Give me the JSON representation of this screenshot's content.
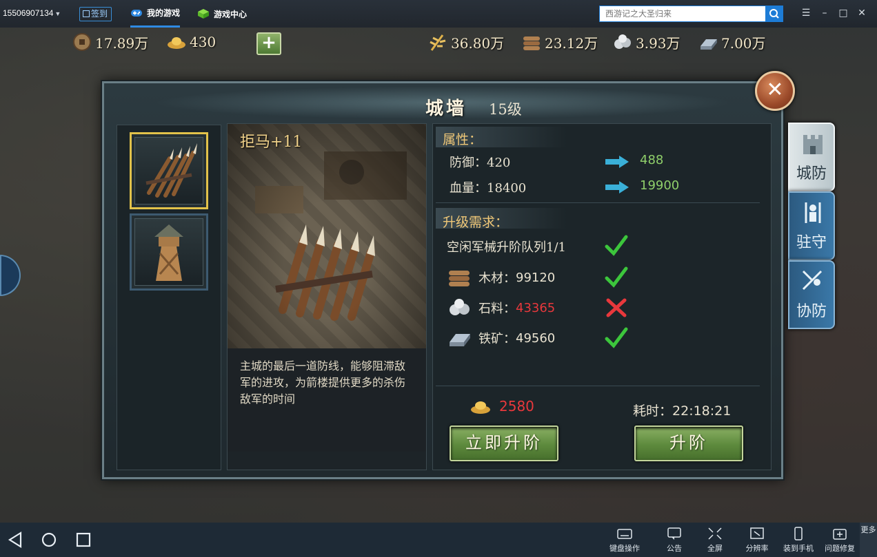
{
  "topbar": {
    "account": "15506907134",
    "signin_label": "签到",
    "tabs": [
      {
        "label": "我的游戏"
      },
      {
        "label": "游戏中心"
      }
    ],
    "search_placeholder": "西游记之大圣归来",
    "window_buttons": [
      "menu-icon",
      "minimize-icon",
      "maximize-icon",
      "close-icon"
    ]
  },
  "resources": {
    "copper": "17.89万",
    "gold": "430",
    "food": "36.80万",
    "wood": "23.12万",
    "stone": "3.93万",
    "iron": "7.00万"
  },
  "dialog": {
    "title": "城墙",
    "level": "15级",
    "item_name": "拒马+11",
    "description": "主城的最后一道防线，能够阻滞敌军的进攻，为箭楼提供更多的杀伤敌军的时间",
    "attributes_head": "属性：",
    "stats": [
      {
        "label": "防御：420",
        "new": "488"
      },
      {
        "label": "血量：18400",
        "new": "19900"
      }
    ],
    "requirements_head": "升级需求：",
    "queue": "空闲军械升阶队列1/1",
    "requirements": [
      {
        "name": "木材：",
        "value": "99120",
        "ok": true
      },
      {
        "name": "石料：",
        "value": "43365",
        "ok": false
      },
      {
        "name": "铁矿：",
        "value": "49560",
        "ok": true
      }
    ],
    "gold_cost": "2580",
    "time_label": "耗时：",
    "time_value": "22:18:21",
    "instant_button": "立即升阶",
    "upgrade_button": "升阶"
  },
  "side_tabs": [
    {
      "label": "城防"
    },
    {
      "label": "驻守"
    },
    {
      "label": "协防"
    }
  ],
  "bottombar": {
    "tools": [
      "键盘操作",
      "公告",
      "全屏",
      "分辨率",
      "装到手机",
      "问题修复"
    ],
    "more": "更多"
  },
  "colors": {
    "accent_blue": "#2f8ae3",
    "button_green": "#5d8a3d",
    "highlight_gold": "#e2c24a",
    "insufficient_red": "#e8383c",
    "stat_green": "#8fcf6a"
  }
}
